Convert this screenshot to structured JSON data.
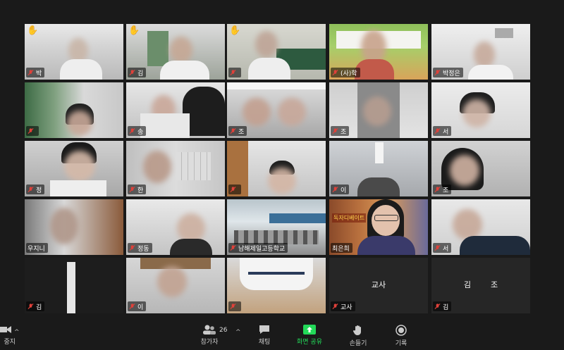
{
  "tiles": [
    {
      "name": "박",
      "hand": true
    },
    {
      "name": "김",
      "hand": true
    },
    {
      "name": "",
      "hand": true
    },
    {
      "name": "(사)학"
    },
    {
      "name": "박정은"
    },
    {
      "name": ""
    },
    {
      "name": "송"
    },
    {
      "name": "조"
    },
    {
      "name": "조"
    },
    {
      "name": "서"
    },
    {
      "name": "정"
    },
    {
      "name": "한"
    },
    {
      "name": ""
    },
    {
      "name": "이"
    },
    {
      "name": "조"
    },
    {
      "name": "우지니"
    },
    {
      "name": "정동"
    },
    {
      "name": "남해제일고등학교"
    },
    {
      "name": "최은희",
      "active": true,
      "banner": "독자디베이트"
    },
    {
      "name": "서"
    },
    {
      "name": "김"
    },
    {
      "name": "이"
    },
    {
      "name": ""
    },
    {
      "name": "교사",
      "center": "교사"
    },
    {
      "name": "김",
      "center": "김        조"
    }
  ],
  "toolbar": {
    "stop_label": "중지",
    "participants_label": "참가자",
    "participants_count": "26",
    "chat_label": "채팅",
    "share_label": "화면 공유",
    "raise_hand_label": "손들기",
    "record_label": "기록"
  },
  "colors": {
    "share": "#23d959",
    "active_border": "#d7ea4a",
    "hand": "#f2c230",
    "mic_muted": "#e0413a"
  }
}
